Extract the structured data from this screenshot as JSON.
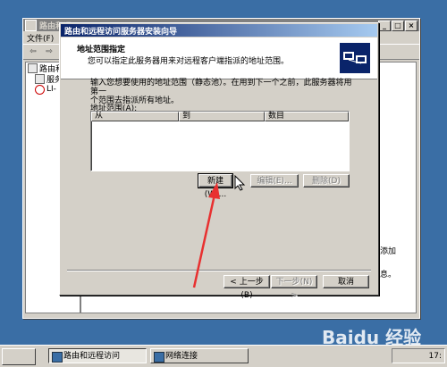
{
  "background_window": {
    "title": "路由和远",
    "menu": [
      "文件(F)"
    ],
    "toolbar_icons": [
      "back-arrow-icon",
      "forward-arrow-icon"
    ],
    "tree": [
      "路由和",
      "服务",
      "LI-"
    ],
    "right_text": [
      "添加",
      "息。"
    ]
  },
  "wizard": {
    "title": "路由和远程访问服务器安装向导",
    "header_title": "地址范围指定",
    "header_subtitle": "您可以指定此服务器用来对远程客户端指派的地址范围。",
    "intro_line1": "输入您想要使用的地址范围（静态池）。在用到下一个之前，此服务器将用第一",
    "intro_line2": "个范围去指派所有地址。",
    "range_label": "地址范围(A):",
    "columns": [
      "从",
      "到",
      "数目"
    ],
    "rows": [],
    "buttons": {
      "new": "新建(W)...",
      "edit": "编辑(E)...",
      "delete": "删除(D)"
    },
    "nav": {
      "back": "< 上一步(B)",
      "next": "下一步(N) >",
      "cancel": "取消"
    }
  },
  "taskbar": {
    "tasks": [
      "路由和远程访问",
      "网络连接"
    ],
    "clock": "17:"
  },
  "watermark": "Baidu 经验",
  "colors": {
    "desktop": "#3a6ea5",
    "title_active": "#0a246a",
    "annotation_arrow": "#e83030"
  }
}
